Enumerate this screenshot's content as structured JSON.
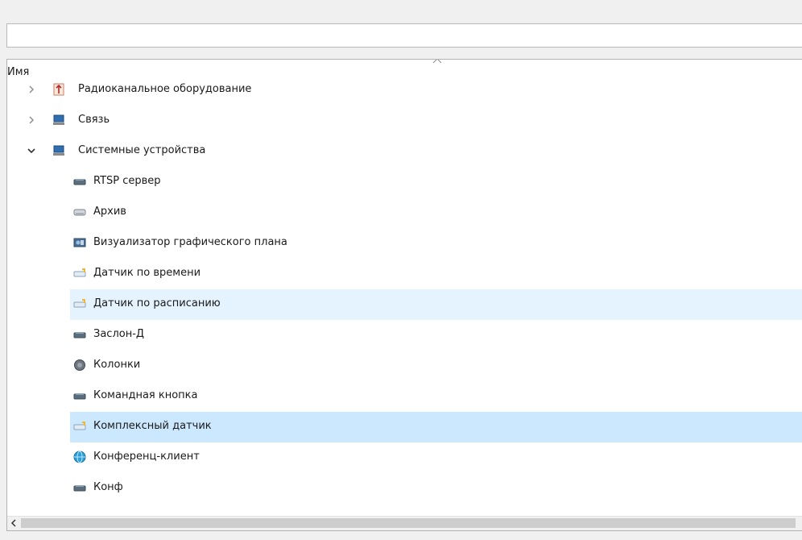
{
  "search": {
    "value": "",
    "placeholder": ""
  },
  "tree": {
    "column_header": "Имя",
    "sort_indicator": "ascending",
    "rows": [
      {
        "label": "Радиоканальное оборудование",
        "level": 0,
        "expander": "collapsed",
        "icon": "radio-antenna-icon",
        "state": ""
      },
      {
        "label": "Связь",
        "level": 0,
        "expander": "collapsed",
        "icon": "computer-icon",
        "state": ""
      },
      {
        "label": "Системные устройства",
        "level": 0,
        "expander": "expanded",
        "icon": "computer-icon",
        "state": ""
      },
      {
        "label": "RTSP сервер",
        "level": 1,
        "expander": "",
        "icon": "device-icon",
        "state": ""
      },
      {
        "label": "Архив",
        "level": 1,
        "expander": "",
        "icon": "drive-icon",
        "state": ""
      },
      {
        "label": "Визуализатор графического плана",
        "level": 1,
        "expander": "",
        "icon": "map-viewer-icon",
        "state": ""
      },
      {
        "label": "Датчик по времени",
        "level": 1,
        "expander": "",
        "icon": "sensor-icon",
        "state": ""
      },
      {
        "label": "Датчик по расписанию",
        "level": 1,
        "expander": "",
        "icon": "sensor-icon",
        "state": "hover"
      },
      {
        "label": "Заслон-Д",
        "level": 1,
        "expander": "",
        "icon": "device-icon",
        "state": ""
      },
      {
        "label": "Колонки",
        "level": 1,
        "expander": "",
        "icon": "speaker-icon",
        "state": ""
      },
      {
        "label": "Командная кнопка",
        "level": 1,
        "expander": "",
        "icon": "device-icon",
        "state": ""
      },
      {
        "label": "Комплексный датчик",
        "level": 1,
        "expander": "",
        "icon": "sensor-icon",
        "state": "selected"
      },
      {
        "label": "Конференц-клиент",
        "level": 1,
        "expander": "",
        "icon": "globe-icon",
        "state": ""
      },
      {
        "label": "Конф",
        "level": 1,
        "expander": "",
        "icon": "device-icon",
        "state": "clipped"
      }
    ]
  },
  "scrollbar": {
    "left_arrow": "<"
  }
}
